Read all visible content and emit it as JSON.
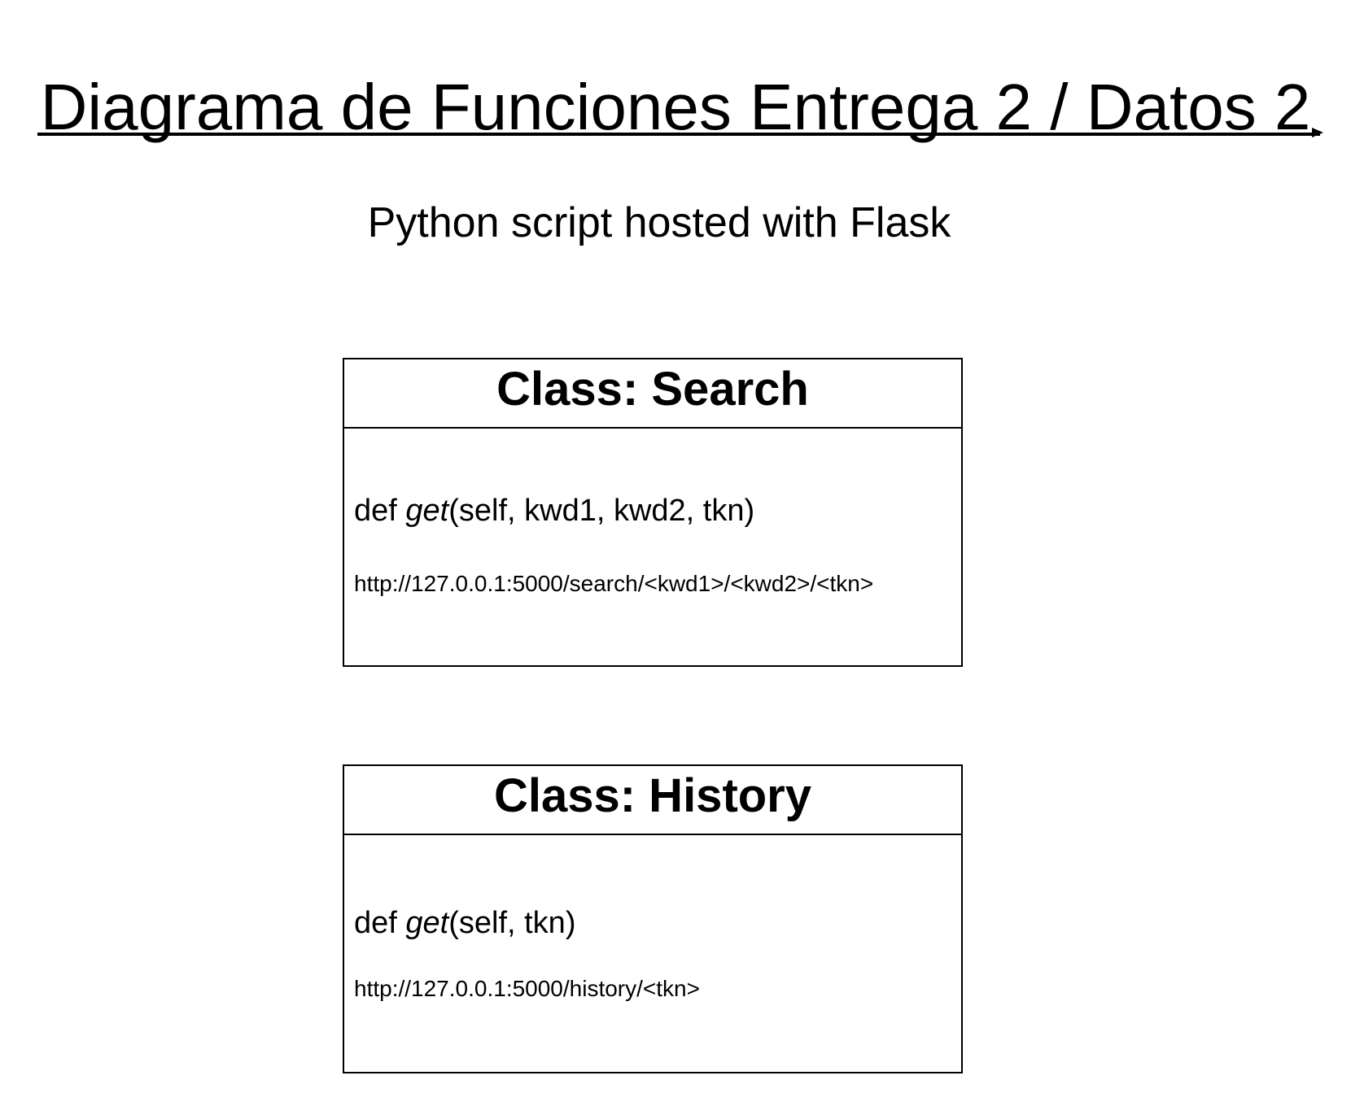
{
  "title": "Diagrama de Funciones Entrega 2 / Datos 2",
  "subtitle": "Python script hosted with Flask",
  "classes": [
    {
      "header": "Class: Search",
      "method": {
        "keyword": "def ",
        "name": "get",
        "params": "(self, kwd1, kwd2, tkn)"
      },
      "route": "http://127.0.0.1:5000/search/<kwd1>/<kwd2>/<tkn>"
    },
    {
      "header": "Class: History",
      "method": {
        "keyword": "def ",
        "name": "get",
        "params": "(self, tkn)"
      },
      "route": "http://127.0.0.1:5000/history/<tkn>"
    }
  ]
}
